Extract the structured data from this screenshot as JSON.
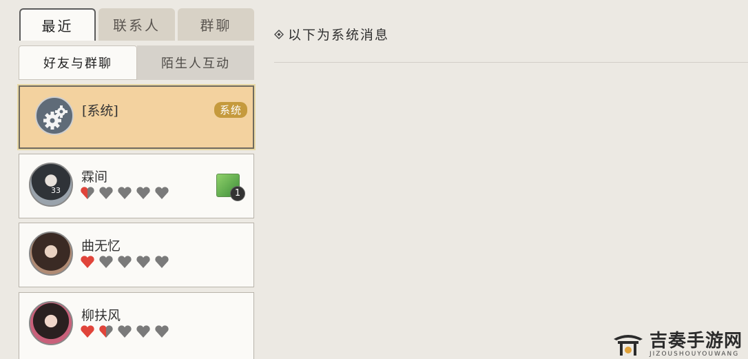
{
  "tabs": {
    "recent": "最近",
    "contacts": "联系人",
    "groups": "群聊"
  },
  "subtabs": {
    "friends_groups": "好友与群聊",
    "strangers": "陌生人互动"
  },
  "conversations": [
    {
      "name": "[系统]",
      "badge": "系统",
      "selected": true
    },
    {
      "name": "霖间",
      "level": "33",
      "hearts_filled": 0.5,
      "hearts_total": 5,
      "gift_count": "1"
    },
    {
      "name": "曲无忆",
      "hearts_filled": 1,
      "hearts_total": 5
    },
    {
      "name": "柳扶风",
      "hearts_filled": 1.5,
      "hearts_total": 5
    }
  ],
  "main": {
    "header": "以下为系统消息"
  },
  "watermark": {
    "title": "吉奏手游网",
    "subtitle": "JIZOUSHOUYOUWANG"
  },
  "colors": {
    "selected_bg": "#f3d29f",
    "badge": "#c59a3d",
    "heart_red": "#e0443a",
    "heart_grey": "#7a7a7a",
    "background": "#ece9e3"
  }
}
